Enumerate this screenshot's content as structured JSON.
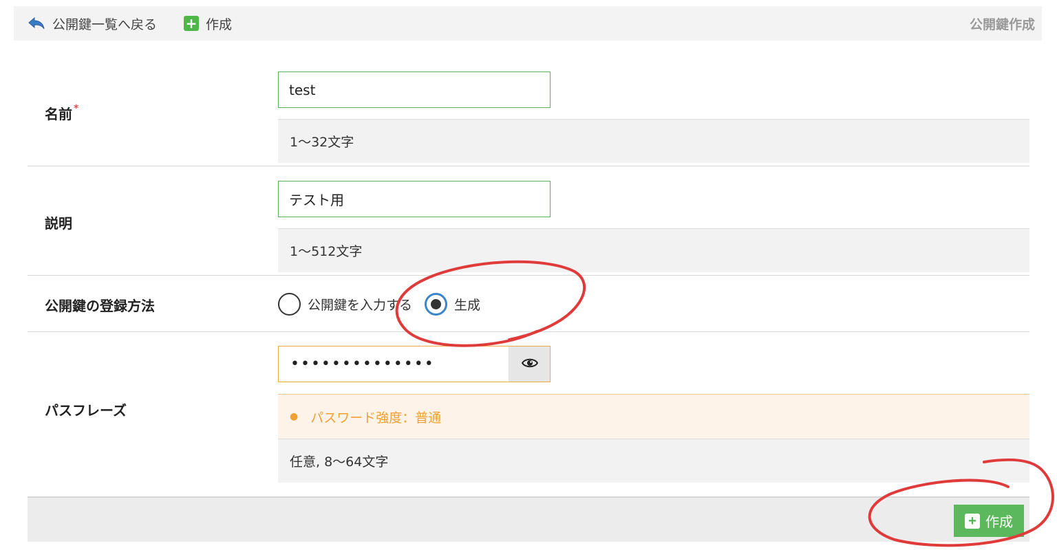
{
  "toolbar": {
    "back_label": "公開鍵一覧へ戻る",
    "create_label": "作成",
    "page_title": "公開鍵作成"
  },
  "form": {
    "name": {
      "label": "名前",
      "required_mark": "*",
      "value": "test",
      "hint": "1〜32文字"
    },
    "description": {
      "label": "説明",
      "value": "テスト用",
      "hint": "1〜512文字"
    },
    "registration": {
      "label": "公開鍵の登録方法",
      "options": [
        {
          "label": "公開鍵を入力する",
          "selected": false
        },
        {
          "label": "生成",
          "selected": true
        }
      ]
    },
    "passphrase": {
      "label": "パスフレーズ",
      "value": "••••••••••••••",
      "strength": "パスワード強度：普通",
      "hint": "任意, 8〜64文字"
    }
  },
  "footer": {
    "submit_label": "作成"
  },
  "colors": {
    "accent_green": "#5cb85c",
    "radio_blue": "#3a86c8",
    "warning_orange": "#f0a030",
    "annotation_red": "#e03b3b"
  },
  "icons": [
    "back-arrow-icon",
    "plus-icon",
    "eye-icon"
  ]
}
